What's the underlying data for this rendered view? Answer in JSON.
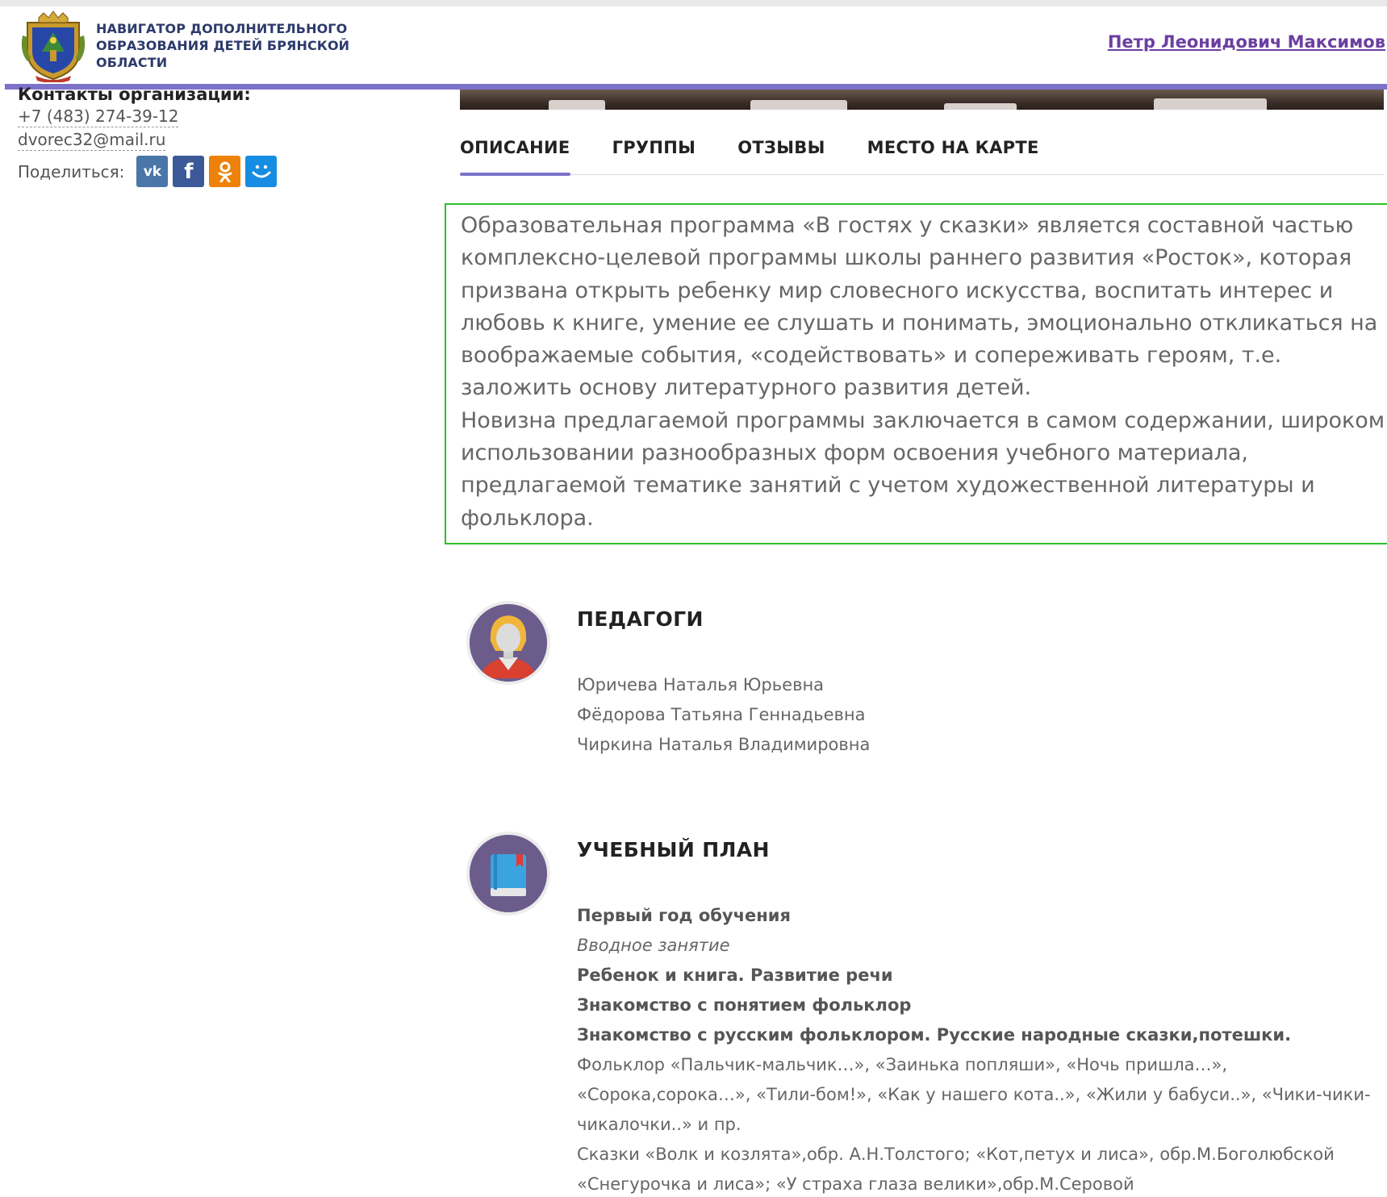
{
  "header": {
    "brand_lines": [
      "НАВИГАТОР ДОПОЛНИТЕЛЬНОГО",
      "ОБРАЗОВАНИЯ ДЕТЕЙ БРЯНСКОЙ",
      "ОБЛАСТИ"
    ],
    "user_name": "Петр Леонидович Максимов",
    "colors": {
      "accent": "#7d72c9",
      "brand_text": "#2c3a6b",
      "user_link": "#6b3fa0"
    }
  },
  "sidebar": {
    "contacts_title": "Контакты организации:",
    "phone": "+7 (483) 274-39-12",
    "email": "dvorec32@mail.ru",
    "share_label": "Поделиться:",
    "share_icons": [
      "vk-icon",
      "facebook-icon",
      "odnoklassniki-icon",
      "mailru-icon"
    ]
  },
  "tabs": [
    {
      "label": "ОПИСАНИЕ",
      "active": true
    },
    {
      "label": "ГРУППЫ",
      "active": false
    },
    {
      "label": "ОТЗЫВЫ",
      "active": false
    },
    {
      "label": "МЕСТО НА КАРТЕ",
      "active": false
    }
  ],
  "description": {
    "paragraphs": [
      "Образовательная программа «В гостях у сказки» является составной частью комплексно-целевой программы школы раннего развития «Росток», которая призвана открыть ребенку мир словесного искусства, воспитать интерес и любовь к книге, умение ее слушать и понимать, эмоционально откликаться на воображаемые события, «содействовать» и сопереживать героям, т.е. заложить основу литературного развития детей.",
      "Новизна предлагаемой программы заключается в самом содержании, широком использовании разнообразных форм освоения учебного материала, предлагаемой тематике занятий с учетом художественной литературы и фольклора."
    ]
  },
  "teachers_section": {
    "title": "ПЕДАГОГИ",
    "teachers": [
      "Юричева Наталья Юрьевна",
      "Фёдорова Татьяна Геннадьевна",
      "Чиркина Наталья Владимировна"
    ]
  },
  "plan_section": {
    "title": "УЧЕБНЫЙ ПЛАН",
    "lines": [
      {
        "text": "Первый год обучения",
        "style": "bold"
      },
      {
        "text": "Вводное занятие",
        "style": "italic"
      },
      {
        "text": "Ребенок и книга. Развитие речи",
        "style": "bold"
      },
      {
        "text": "Знакомство с понятием фольклор",
        "style": "bold"
      },
      {
        "text": "Знакомство с русским фольклором. Русские народные сказки,потешки.",
        "style": "bold"
      },
      {
        "text": "Фольклор «Пальчик-мальчик…», «Заинька попляши», «Ночь пришла…», «Сорока,сорока…», «Тили-бом!», «Как у нашего кота..», «Жили у бабуси..», «Чики-чики-чикалочки..» и пр.",
        "style": "normal"
      },
      {
        "text": "Сказки «Волк и козлята»,обр. А.Н.Толстого; «Кот,петух и лиса», обр.М.Боголюбской «Снегурочка и лиса»; «У страха глаза велики»,обр.М.Серовой",
        "style": "normal"
      }
    ]
  }
}
